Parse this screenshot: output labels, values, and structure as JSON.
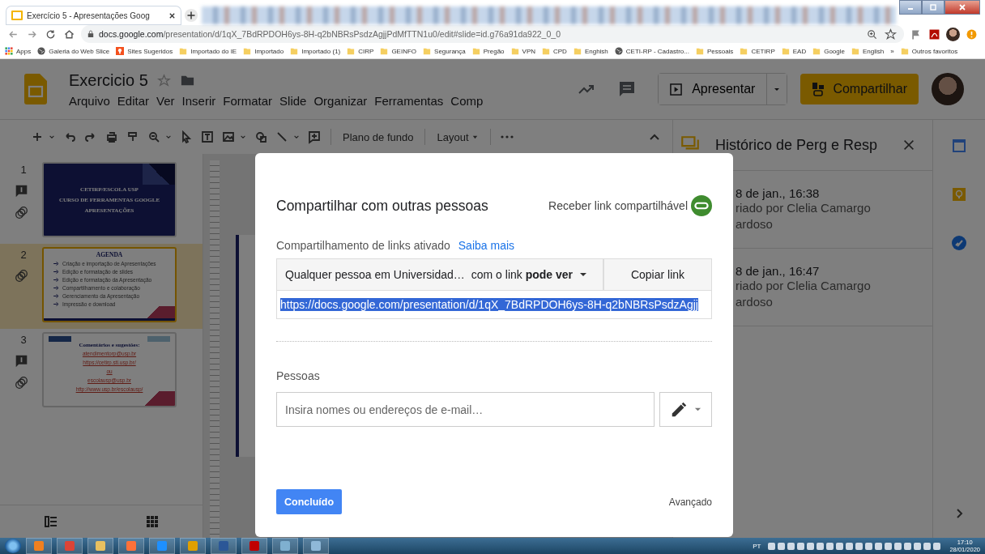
{
  "browser": {
    "tabs": [
      {
        "title": "Exercício 5 - Apresentações Goog",
        "selected": true
      }
    ],
    "address": {
      "host": "docs.google.com",
      "path": "/presentation/d/1qX_7BdRPDOH6ys-8H-q2bNBRsPsdzAgjjPdMfTTN1u0/edit#slide=id.g76a91da922_0_0"
    },
    "bookmarks": [
      {
        "label": "Apps",
        "kind": "apps"
      },
      {
        "label": "Galeria do Web Slice",
        "kind": "globe"
      },
      {
        "label": "Sites Sugeridos",
        "kind": "site"
      },
      {
        "label": "Importado do IE",
        "kind": "folder"
      },
      {
        "label": "Importado",
        "kind": "folder"
      },
      {
        "label": "Importado (1)",
        "kind": "folder"
      },
      {
        "label": "CIRP",
        "kind": "folder"
      },
      {
        "label": "GEINFO",
        "kind": "folder"
      },
      {
        "label": "Segurança",
        "kind": "folder"
      },
      {
        "label": "Pregão",
        "kind": "folder"
      },
      {
        "label": "VPN",
        "kind": "folder"
      },
      {
        "label": "CPD",
        "kind": "folder"
      },
      {
        "label": "Enghish",
        "kind": "folder"
      },
      {
        "label": "CETI-RP - Cadastro...",
        "kind": "globe"
      },
      {
        "label": "Pessoais",
        "kind": "folder"
      },
      {
        "label": "CETIRP",
        "kind": "folder"
      },
      {
        "label": "EAD",
        "kind": "folder"
      },
      {
        "label": "Google",
        "kind": "folder"
      },
      {
        "label": "English",
        "kind": "folder"
      },
      {
        "label": "»",
        "kind": "more"
      },
      {
        "label": "Outros favoritos",
        "kind": "folder"
      }
    ]
  },
  "app": {
    "title": "Exercicio 5",
    "menu": [
      "Arquivo",
      "Editar",
      "Ver",
      "Inserir",
      "Formatar",
      "Slide",
      "Organizar",
      "Ferramentas",
      "Comp"
    ],
    "present_button": "Apresentar",
    "share_button": "Compartilhar",
    "toolbar": {
      "background_button": "Plano de fundo",
      "layout_button": "Layout"
    }
  },
  "slides": [
    {
      "number": "1",
      "kind": "title",
      "has_comment": true,
      "selected": false,
      "heading": "CETIRP/ESCOLA USP",
      "lines": [
        "CURSO DE FERRAMENTAS GOOGLE",
        "APRESENTAÇÕES"
      ]
    },
    {
      "number": "2",
      "kind": "agenda",
      "has_comment": false,
      "selected": true,
      "heading": "AGENDA",
      "lines": [
        "Criação e importação de Apresentações",
        "Edição e formatação de slides",
        "Edição e formatação da Apresentação",
        "Compartilhamento e colaboração",
        "Gerenciamento da Apresentação",
        "Impressão e download"
      ]
    },
    {
      "number": "3",
      "kind": "contact",
      "has_comment": true,
      "selected": false,
      "heading": "Comentários e sugestões:",
      "lines": [
        "atendimentorp@usp.br",
        "https://cetirp.sti.usp.br/",
        "ou",
        "escolausp@usp.br",
        "http://www.usp.br/escolausp/"
      ]
    }
  ],
  "qa_panel": {
    "title": "Histórico de Perg e Resp",
    "items": [
      {
        "date": "8 de jan., 16:38",
        "author": [
          "riado por Clelia Camargo",
          "ardoso"
        ]
      },
      {
        "date": "8 de jan., 16:47",
        "author": [
          "riado por Clelia Camargo",
          "ardoso"
        ]
      }
    ]
  },
  "dialog": {
    "title": "Compartilhar com outras pessoas",
    "get_link": "Receber link compartilhável",
    "link_status": "Compartilhamento de links ativado",
    "learn_more": "Saiba mais",
    "access_dropdown": {
      "audience": "Qualquer pessoa em Universidad…",
      "permission": "com o link **pode ver**"
    },
    "copy_button": "Copiar link",
    "url": "https://docs.google.com/presentation/d/1qX_7BdRPDOH6ys-8H-q2bNBRsPsdzAgjj",
    "url_selected": true,
    "people_label": "Pessoas",
    "people_field": {
      "placeholder": "Insira nomes ou endereços de e-mail…"
    },
    "done_button": "Concluído",
    "advanced_link": "Avançado"
  },
  "taskbar": {
    "language": "PT",
    "time": "17:10",
    "date": "28/01/2020"
  }
}
